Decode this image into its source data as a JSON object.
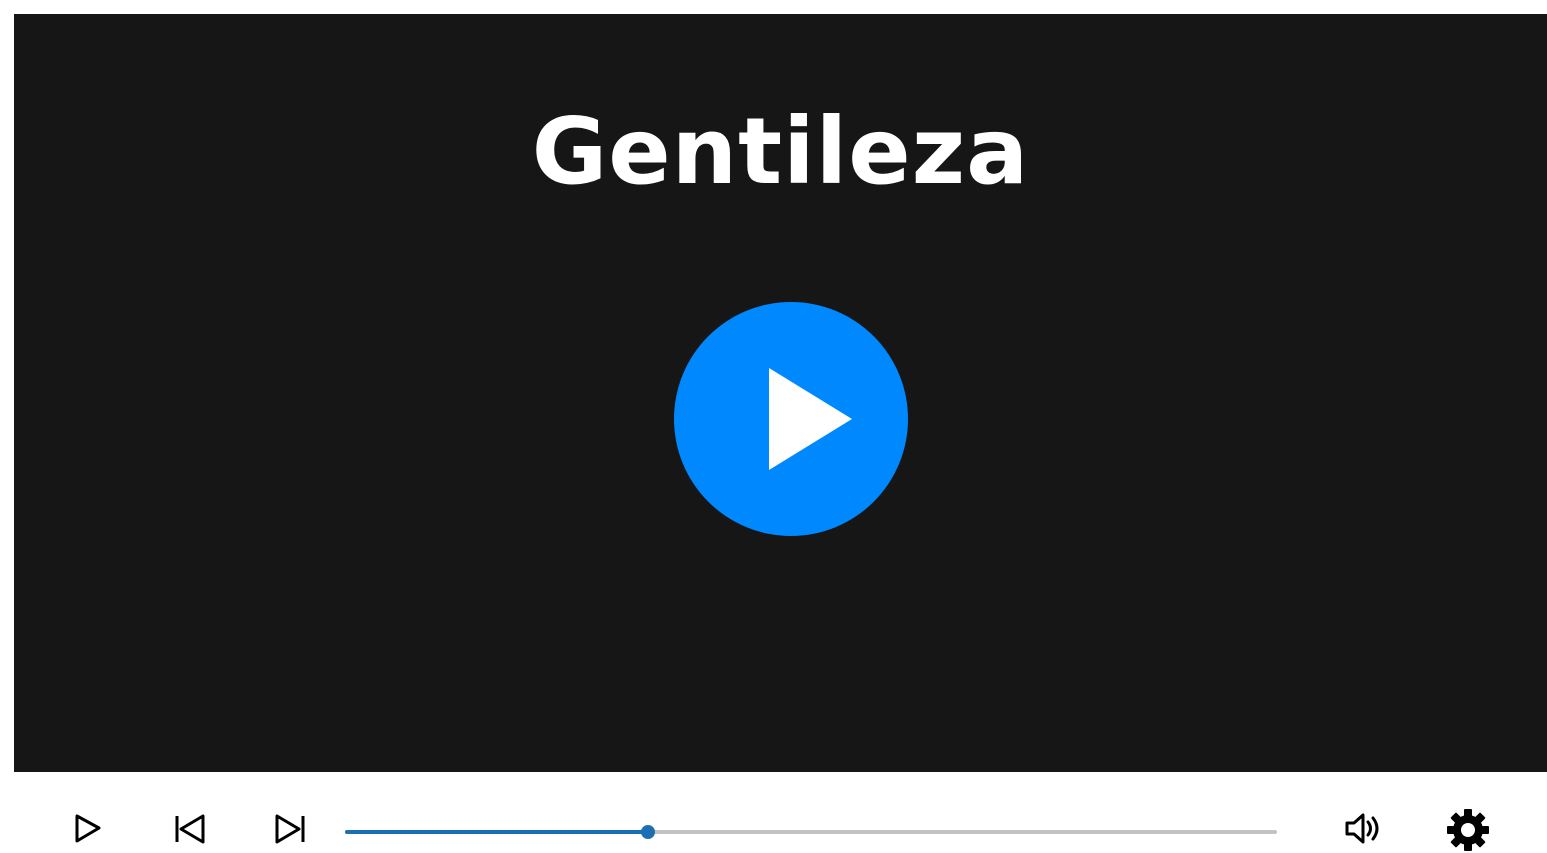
{
  "video": {
    "title": "Gentileza"
  },
  "controls": {
    "progress": 0.325
  },
  "icons": {
    "big_play": "play-circle-icon",
    "play": "play-icon",
    "previous": "skip-previous-icon",
    "next": "skip-next-icon",
    "volume": "volume-icon",
    "settings": "gear-icon"
  },
  "colors": {
    "screen_bg": "#161616",
    "accent": "#0088ff",
    "progress_fill": "#1d6fb3",
    "progress_track": "#c2c2c2",
    "icon": "#000000",
    "title": "#ffffff"
  }
}
